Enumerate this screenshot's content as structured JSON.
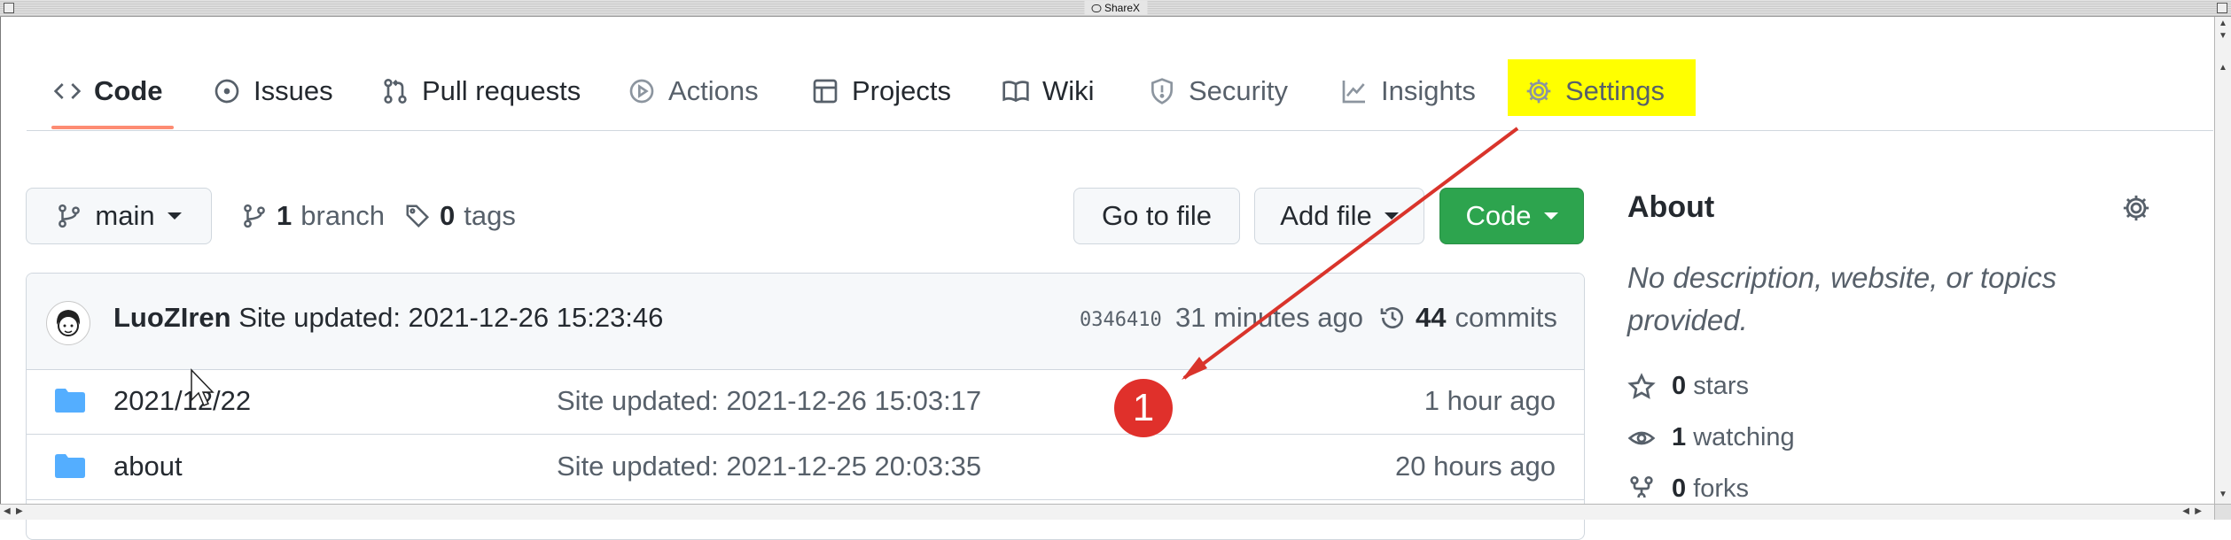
{
  "window": {
    "title": "ShareX"
  },
  "nav": {
    "tabs": [
      {
        "label": "Code",
        "icon": "code-icon"
      },
      {
        "label": "Issues",
        "icon": "issue-icon"
      },
      {
        "label": "Pull requests",
        "icon": "pull-request-icon"
      },
      {
        "label": "Actions",
        "icon": "play-icon"
      },
      {
        "label": "Projects",
        "icon": "table-icon"
      },
      {
        "label": "Wiki",
        "icon": "book-icon"
      },
      {
        "label": "Security",
        "icon": "shield-icon"
      },
      {
        "label": "Insights",
        "icon": "graph-icon"
      },
      {
        "label": "Settings",
        "icon": "gear-icon"
      }
    ],
    "active_tab": "Code",
    "highlighted_tab": "Settings",
    "highlight_color": "#ffff00"
  },
  "repo_toolbar": {
    "branch_select": "main",
    "branch_count": "1",
    "branch_label": "branch",
    "tag_count": "0",
    "tag_label": "tags",
    "goto_file": "Go to file",
    "add_file": "Add file",
    "code_button": "Code"
  },
  "latest_commit": {
    "author": "LuoZIren",
    "message": "Site updated: 2021-12-26 15:23:46",
    "sha": "0346410",
    "time": "31 minutes ago",
    "commit_count": "44",
    "commit_label": "commits"
  },
  "files": [
    {
      "name": "2021/12/22",
      "message": "Site updated: 2021-12-26 15:03:17",
      "age": "1 hour ago"
    },
    {
      "name": "about",
      "message": "Site updated: 2021-12-25 20:03:35",
      "age": "20 hours ago"
    }
  ],
  "about": {
    "title": "About",
    "description": "No description, website, or topics provided.",
    "stars_count": "0",
    "stars_label": "stars",
    "watching_count": "1",
    "watching_label": "watching",
    "forks_count": "0",
    "forks_label": "forks"
  },
  "annotation": {
    "marker_number": "1",
    "color": "#d9342b"
  },
  "colors": {
    "accent_underline": "#fd8c73",
    "primary_green": "#2da44e",
    "folder": "#54aeff"
  }
}
